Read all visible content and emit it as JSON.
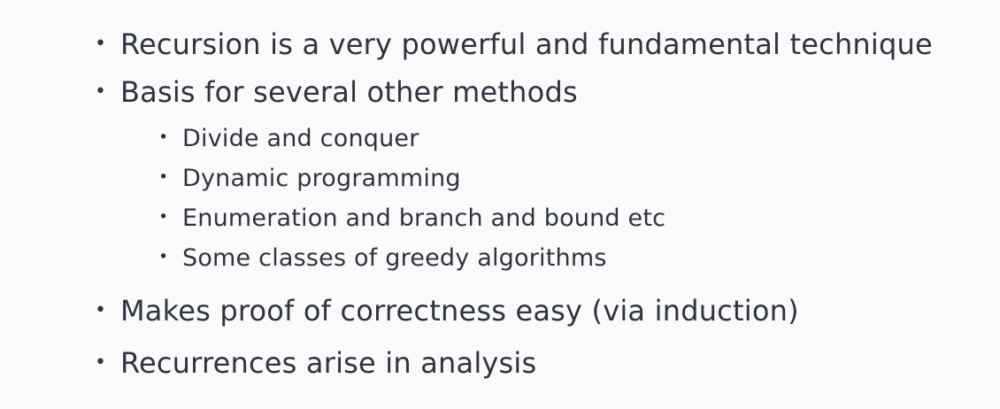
{
  "bullets": [
    {
      "text": "Recursion is a very powerful and fundamental technique"
    },
    {
      "text": "Basis for several other methods",
      "subitems": [
        {
          "text": "Divide and conquer"
        },
        {
          "text": "Dynamic programming"
        },
        {
          "text": "Enumeration and branch and bound etc"
        },
        {
          "text": "Some classes of greedy algorithms"
        }
      ]
    },
    {
      "text": "Makes proof of correctness easy (via induction)"
    },
    {
      "text": "Recurrences arise in analysis"
    }
  ],
  "bullet_symbol": "•",
  "colors": {
    "background": "#fafafa",
    "text": "#2e3440"
  }
}
